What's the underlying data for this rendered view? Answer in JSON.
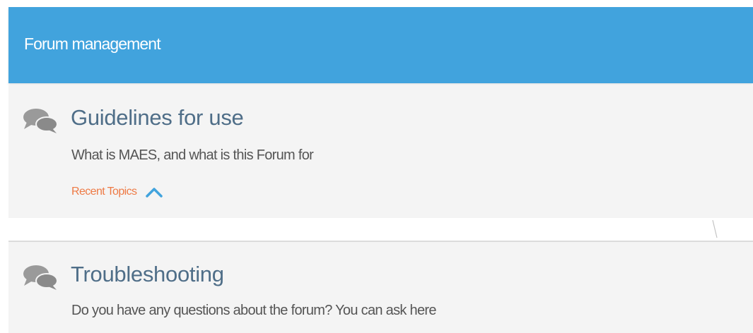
{
  "header": {
    "title": "Forum management",
    "background_color": "#41a3dd"
  },
  "forums": [
    {
      "title": "Guidelines for use",
      "description": "What is MAES, and what is this Forum for",
      "recent_topics_label": "Recent Topics",
      "icon": "speech-bubbles-icon",
      "expanded_indicator": "chevron-up-icon"
    },
    {
      "title": "Troubleshooting",
      "description": "Do you have any questions about the forum? You can ask here",
      "icon": "speech-bubbles-icon"
    }
  ],
  "colors": {
    "card_background": "#f4f4f4",
    "title_text": "#4f6e88",
    "description_text": "#555555",
    "recent_topics_accent": "#ee7a45",
    "chevron": "#41a3dd",
    "icon_gray": "#8f8f8f"
  }
}
